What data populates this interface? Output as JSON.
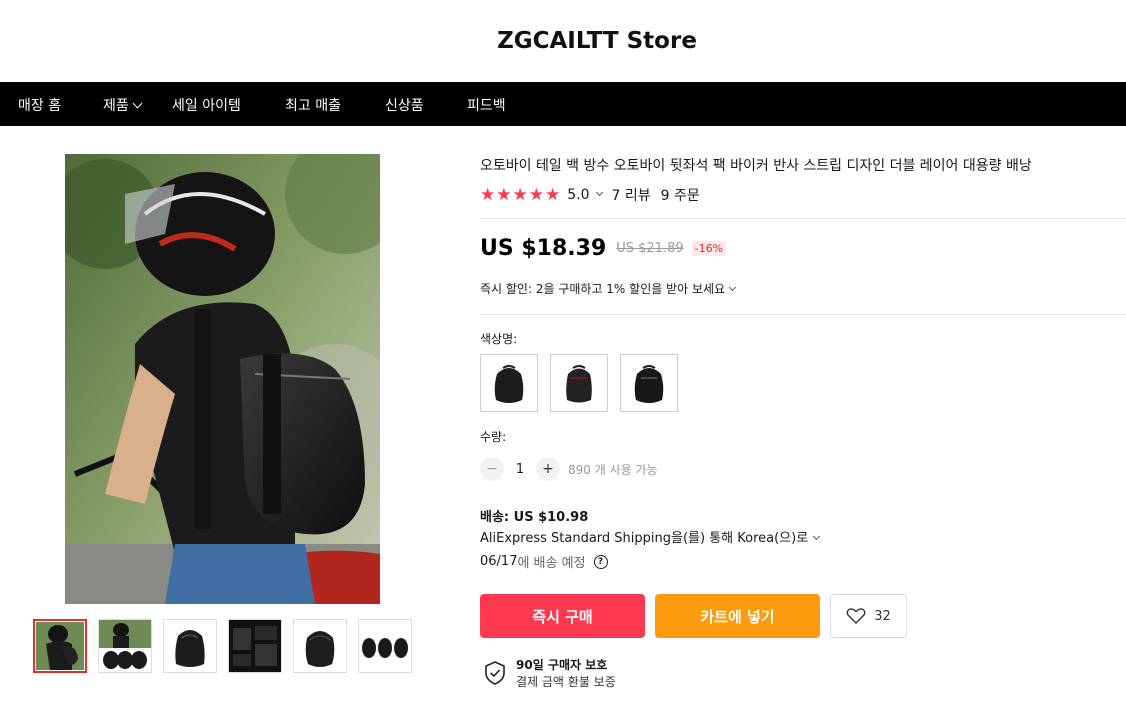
{
  "store": {
    "title": "ZGCAILTT Store"
  },
  "nav": {
    "items": [
      {
        "label": "매장 홈",
        "has_dropdown": false
      },
      {
        "label": "제품",
        "has_dropdown": true
      },
      {
        "label": "세일 아이템",
        "has_dropdown": false
      },
      {
        "label": "최고 매출",
        "has_dropdown": false
      },
      {
        "label": "신상품",
        "has_dropdown": false
      },
      {
        "label": "피드백",
        "has_dropdown": false
      }
    ]
  },
  "gallery": {
    "thumbnail_count": 6,
    "active_index": 0,
    "icons": [
      "rider-photo-thumb",
      "rider-bags-thumb",
      "bag-front-thumb",
      "bag-detail-thumb",
      "bag-side-thumb",
      "bag-trio-thumb"
    ]
  },
  "product": {
    "title": "오토바이 테일 백 방수 오토바이 뒷좌석 팩 바이커 반사 스트립 디자인 더블 레이어 대용량 배낭",
    "rating": "5.0",
    "reviews": "7 리뷰",
    "orders": "9 주문",
    "price": "US $18.39",
    "original_price": "US $21.89",
    "discount": "-16%",
    "instant_discount": "즉시 할인: 2을 구매하고 1% 할인을 받아 보세요",
    "color_label": "색상명:",
    "quantity_label": "수량:",
    "quantity": "1",
    "available": "890 개 사용 가능",
    "shipping_label": "배송: US $10.98",
    "shipping_method": "AliExpress Standard Shipping을(를) 통해 Korea(으)로",
    "delivery_date": "06/17",
    "delivery_suffix": "에 배송 예정"
  },
  "actions": {
    "buy_now": "즉시 구매",
    "add_to_cart": "카트에 넣기",
    "wishlist_count": "32"
  },
  "protection": {
    "title": "90일 구매자 보호",
    "subtitle": "결제 금액 환불 보증"
  },
  "colors": {
    "accent_red": "#fd384f",
    "accent_orange": "#fd9b0e",
    "nav_bg": "#000000"
  }
}
